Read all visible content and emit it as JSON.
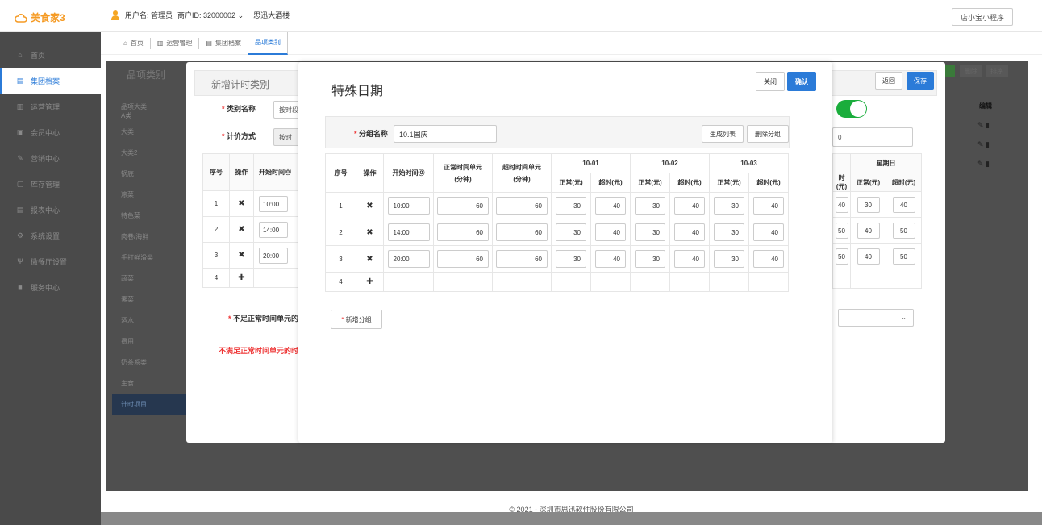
{
  "app": {
    "logo": "美食家3",
    "user_label": "用户名: 管理员",
    "merchant_label": "商户ID: 32000002",
    "store_name": "思迅大酒楼",
    "mini_program": "店小宝小程序"
  },
  "sidebar": {
    "items": [
      {
        "label": "首页",
        "icon": "home-icon",
        "glyph": "⌂"
      },
      {
        "label": "集团档案",
        "icon": "file-icon",
        "glyph": "▤",
        "active": true
      },
      {
        "label": "运营管理",
        "icon": "chart-icon",
        "glyph": "▥"
      },
      {
        "label": "会员中心",
        "icon": "card-icon",
        "glyph": "▣"
      },
      {
        "label": "营销中心",
        "icon": "edit-icon",
        "glyph": "✎"
      },
      {
        "label": "库存管理",
        "icon": "box-icon",
        "glyph": "▢"
      },
      {
        "label": "报表中心",
        "icon": "report-icon",
        "glyph": "▤"
      },
      {
        "label": "系统设置",
        "icon": "settings-icon",
        "glyph": "⚙"
      },
      {
        "label": "微餐厅设置",
        "icon": "restaurant-icon",
        "glyph": "Ψ"
      },
      {
        "label": "服务中心",
        "icon": "service-icon",
        "glyph": "■"
      }
    ]
  },
  "tabs": [
    {
      "label": "首页",
      "icon": "home-icon"
    },
    {
      "label": "运营管理",
      "icon": "chart-icon"
    },
    {
      "label": "集团档案",
      "icon": "file-icon"
    },
    {
      "label": "品项类别",
      "active": true
    }
  ],
  "background": {
    "panel_title": "品项类别",
    "categories": [
      "品项大类",
      "A类",
      "大类",
      "大类2",
      "锅底",
      "凉菜",
      "特色菜",
      "肉卷/海鲜",
      "手打鲜滑类",
      "蔬菜",
      "素菜",
      "酒水",
      "费用",
      "奶茶系类",
      "主食",
      "计时项目"
    ],
    "buttons": [
      "删除",
      "排序"
    ],
    "edit_header": "编辑"
  },
  "modal1": {
    "title": "新增计时类别",
    "back": "返回",
    "save": "保存",
    "name_label": "类别名称",
    "name_value": "按时段",
    "pricing_label": "计价方式",
    "pricing_value": "按时",
    "extra_value": "0",
    "shortage_label": "不足正常时间单元的",
    "red_note": "不满足正常时间单元的时",
    "table": {
      "headers": [
        "序号",
        "操作",
        "开始时间"
      ],
      "sunday": "星期日",
      "sub": [
        "正常(元)",
        "超时(元)"
      ],
      "rows": [
        {
          "no": "1",
          "time": "10:00",
          "a": "40",
          "n": "30",
          "o": "40"
        },
        {
          "no": "2",
          "time": "14:00",
          "a": "50",
          "n": "40",
          "o": "50"
        },
        {
          "no": "3",
          "time": "20:00",
          "a": "50",
          "n": "40",
          "o": "50"
        },
        {
          "no": "4"
        }
      ],
      "partial_header": "时(元)"
    }
  },
  "modal2": {
    "title": "特殊日期",
    "close": "关闭",
    "confirm": "确认",
    "group_label": "分组名称",
    "group_value": "10.1国庆",
    "generate": "生成列表",
    "delete_group": "删除分组",
    "new_group": "新增分组",
    "table": {
      "headers": {
        "no": "序号",
        "op": "操作",
        "start": "开始时间",
        "normal_unit": "正常时间单元",
        "normal_unit2": "(分钟)",
        "over_unit": "超时时间单元",
        "over_unit2": "(分钟)"
      },
      "dates": [
        "10-01",
        "10-02",
        "10-03"
      ],
      "sub": [
        "正常(元)",
        "超时(元)"
      ],
      "rows": [
        {
          "no": "1",
          "time": "10:00",
          "nu": "60",
          "ou": "60",
          "p": [
            "30",
            "40",
            "30",
            "40",
            "30",
            "40"
          ]
        },
        {
          "no": "2",
          "time": "14:00",
          "nu": "60",
          "ou": "60",
          "p": [
            "30",
            "40",
            "30",
            "40",
            "30",
            "40"
          ]
        },
        {
          "no": "3",
          "time": "20:00",
          "nu": "60",
          "ou": "60",
          "p": [
            "30",
            "40",
            "30",
            "40",
            "30",
            "40"
          ]
        },
        {
          "no": "4"
        }
      ]
    }
  },
  "footer": "© 2021 - 深圳市思迅软件股份有限公司",
  "colors": {
    "primary": "#2b7bd8",
    "toggle": "#1aad3c",
    "sidebar": "#4a4a4a",
    "warning": "#e33333"
  }
}
